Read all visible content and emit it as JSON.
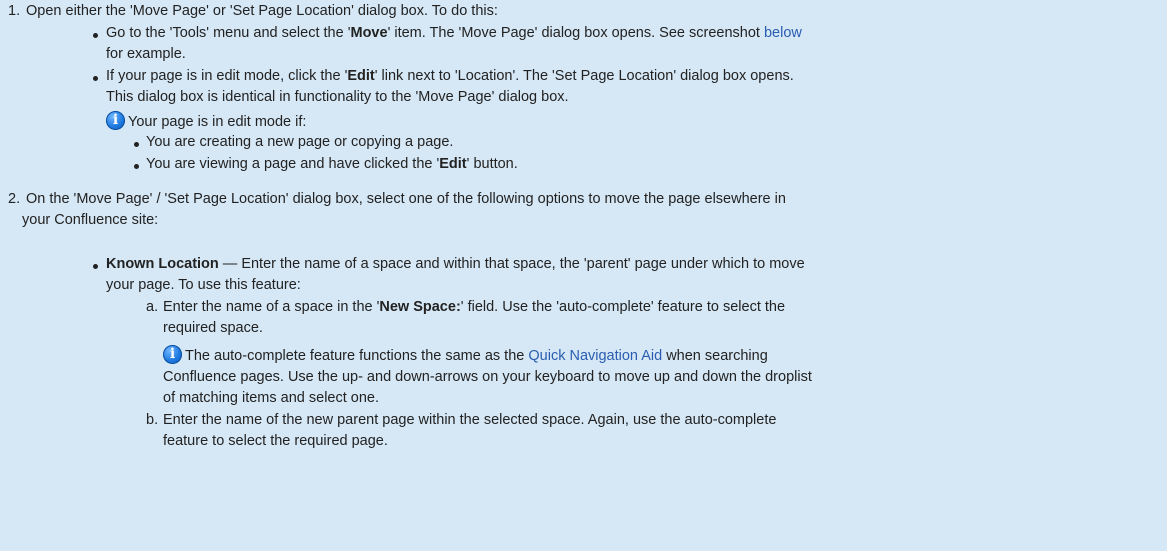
{
  "step1": {
    "number": "1.",
    "text": "Open either the 'Move Page' or 'Set Page Location' dialog box. To do this:",
    "b1": {
      "t1": "Go to the 'Tools' menu and select the '",
      "bold": "Move",
      "t2": "' item. The 'Move Page' dialog box opens. See screenshot ",
      "link": "below",
      "cont": "for example."
    },
    "b2": {
      "t1": "If your page is in edit mode, click the '",
      "bold": "Edit",
      "t2": "' link next to 'Location'. The 'Set Page Location' dialog box opens.",
      "cont": "This dialog box is identical in functionality to the 'Move Page' dialog box."
    },
    "note": "Your page is in edit mode if:",
    "cases": [
      "You are creating a new page or copying a page."
    ],
    "case2": {
      "t1": "You are viewing a page and have clicked the '",
      "bold": "Edit",
      "t2": "' button."
    }
  },
  "step2": {
    "number": "2.",
    "line1": "On the 'Move Page' / 'Set Page Location' dialog box, select one of the following options to move the page elsewhere in",
    "line2": "your Confluence site:",
    "known": {
      "bold": "Known Location",
      "t1": " — Enter the name of a space and within that space, the 'parent' page under which to move",
      "cont": "your page. To use this feature:"
    },
    "a": {
      "letter": "a.",
      "t1": "Enter the name of a space in the '",
      "bold": "New Space:",
      "t2": "' field. Use the 'auto-complete' feature to select the",
      "cont": "required space.",
      "note": {
        "t1": "The auto-complete feature functions the same as the ",
        "link": "Quick Navigation Aid",
        "t2": " when searching",
        "cont1": "Confluence pages. Use the up- and down-arrows on your keyboard to move up and down the droplist",
        "cont2": "of matching items and select one."
      }
    },
    "b": {
      "letter": "b.",
      "text": "Enter the name of the new parent page within the selected space. Again, use the auto-complete",
      "cont": "feature to select the required page."
    }
  }
}
